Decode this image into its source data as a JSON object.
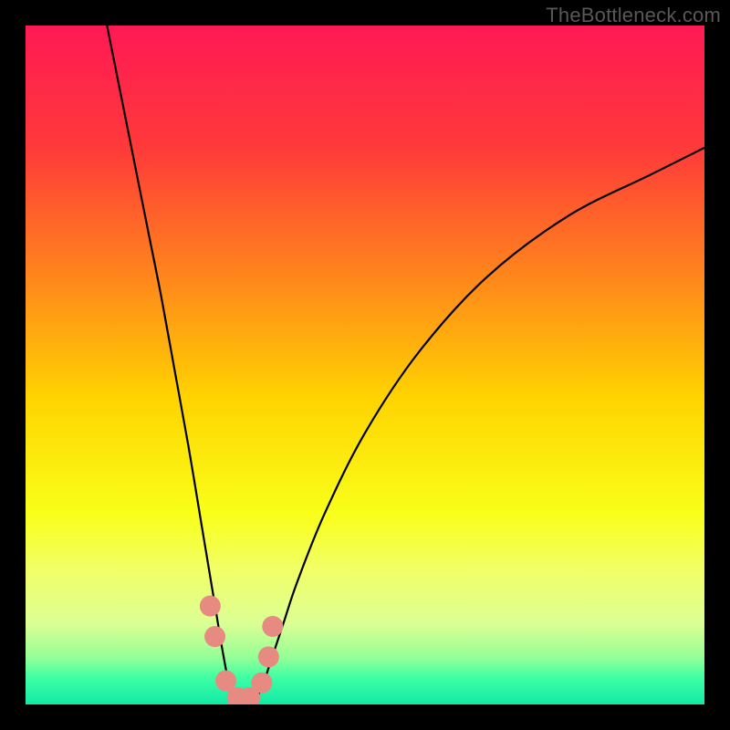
{
  "watermark": "TheBottleneck.com",
  "chart_data": {
    "type": "line",
    "title": "",
    "xlabel": "",
    "ylabel": "",
    "xlim": [
      0,
      100
    ],
    "ylim": [
      0,
      100
    ],
    "gradient_stops": [
      {
        "offset": 0,
        "color": "#ff1954"
      },
      {
        "offset": 18,
        "color": "#ff3a3a"
      },
      {
        "offset": 38,
        "color": "#ff8a1a"
      },
      {
        "offset": 55,
        "color": "#ffd400"
      },
      {
        "offset": 72,
        "color": "#f9ff1a"
      },
      {
        "offset": 80,
        "color": "#f2ff66"
      },
      {
        "offset": 88,
        "color": "#dcff94"
      },
      {
        "offset": 93,
        "color": "#96ff96"
      },
      {
        "offset": 96,
        "color": "#3fffa4"
      },
      {
        "offset": 100,
        "color": "#11e9a6"
      }
    ],
    "series": [
      {
        "name": "bottleneck-curve",
        "x": [
          12,
          14,
          16,
          18,
          20,
          22,
          24,
          26,
          27,
          28,
          29,
          30,
          31,
          32,
          33,
          34,
          35,
          36,
          38,
          40,
          44,
          50,
          58,
          68,
          80,
          92,
          100
        ],
        "y": [
          100,
          90,
          80,
          70,
          60,
          49,
          38,
          26,
          20,
          14,
          8,
          3,
          1,
          0.5,
          0.5,
          1,
          3,
          6,
          12,
          18,
          28,
          40,
          52,
          63,
          72,
          78,
          82
        ]
      }
    ],
    "highlight_markers": {
      "name": "target-zone",
      "x": [
        27.2,
        27.9,
        29.5,
        31.2,
        33.0,
        34.8,
        35.8,
        36.4
      ],
      "y": [
        14.5,
        10.0,
        3.5,
        1.0,
        1.0,
        3.2,
        7.0,
        11.5
      ]
    },
    "marker_color": "#e68a82",
    "curve_color": "#000000"
  }
}
